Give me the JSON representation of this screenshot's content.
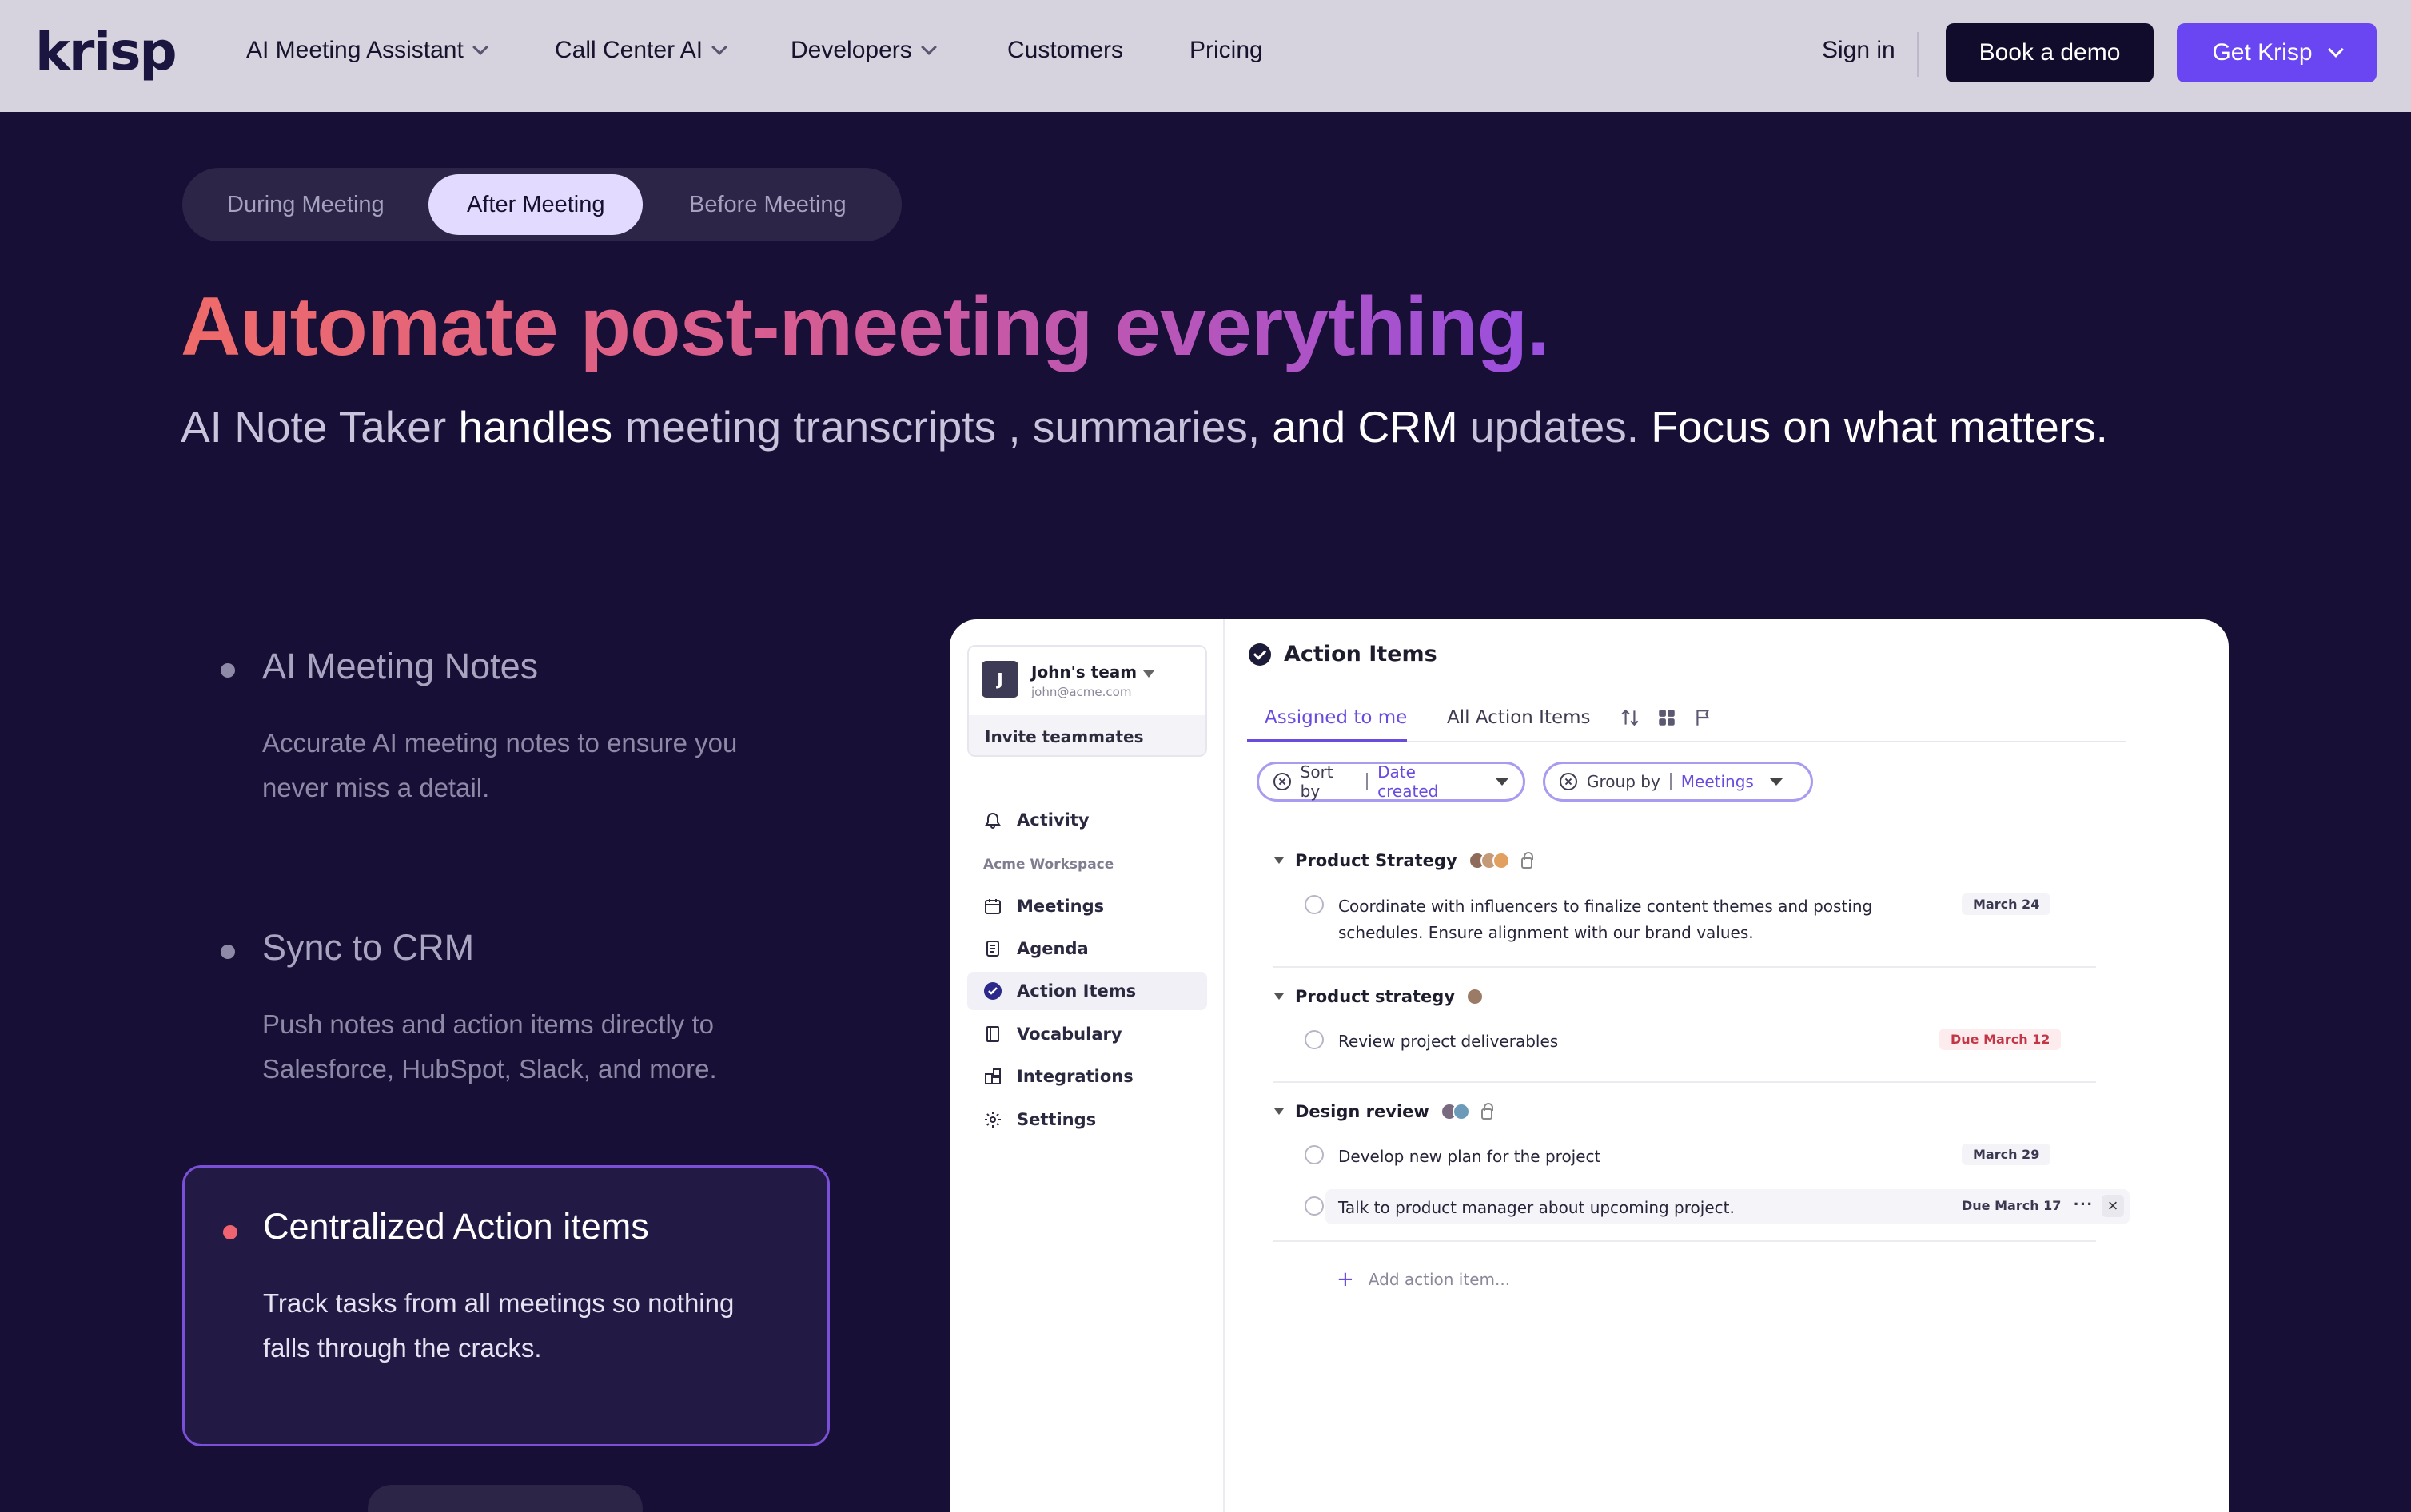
{
  "nav": {
    "logo": "krisp",
    "items": [
      {
        "label": "AI Meeting Assistant",
        "has_dropdown": true
      },
      {
        "label": "Call Center AI",
        "has_dropdown": true
      },
      {
        "label": "Developers",
        "has_dropdown": true
      },
      {
        "label": "Customers",
        "has_dropdown": false
      },
      {
        "label": "Pricing",
        "has_dropdown": false
      }
    ],
    "sign_in": "Sign in",
    "book_demo": "Book a demo",
    "get_krisp": "Get Krisp"
  },
  "tabs": [
    {
      "label": "During Meeting",
      "active": false
    },
    {
      "label": "After Meeting",
      "active": true
    },
    {
      "label": "Before Meeting",
      "active": false
    }
  ],
  "hero": {
    "title": "Automate post-meeting everything.",
    "subtitle_parts": [
      "AI Note Taker ",
      "handles",
      " meeting transcripts , summaries, ",
      "and CRM",
      " updates. ",
      "Focus on what matters."
    ]
  },
  "features": [
    {
      "title": "AI Meeting Notes",
      "text": "Accurate AI meeting notes to ensure you never miss a detail."
    },
    {
      "title": "Sync to CRM",
      "text": "Push notes and action items directly to Salesforce, HubSpot, Slack, and more."
    },
    {
      "title": "Centralized Action items",
      "text": "Track tasks from all meetings so nothing falls through the cracks.",
      "active": true
    }
  ],
  "app": {
    "team": {
      "avatar": "J",
      "name": "John's team",
      "email": "john@acme.com",
      "invite": "Invite teammates"
    },
    "sidebar": {
      "activity": "Activity",
      "section": "Acme Workspace",
      "items": [
        {
          "label": "Meetings",
          "icon": "calendar-icon"
        },
        {
          "label": "Agenda",
          "icon": "document-icon"
        },
        {
          "label": "Action Items",
          "icon": "check-circle-icon",
          "active": true
        },
        {
          "label": "Vocabulary",
          "icon": "book-icon"
        },
        {
          "label": "Integrations",
          "icon": "puzzle-icon"
        },
        {
          "label": "Settings",
          "icon": "gear-icon"
        }
      ]
    },
    "title": "Action Items",
    "subtabs": [
      "Assigned to me",
      "All Action Items"
    ],
    "filters": {
      "sort_label": "Sort by",
      "sort_value": "Date created",
      "group_label": "Group by",
      "group_value": "Meetings"
    },
    "groups": [
      {
        "name": "Product Strategy",
        "tasks": [
          {
            "text": "Coordinate with influencers to finalize content themes and posting schedules. Ensure alignment with our brand values.",
            "date": "March 24",
            "due": false
          }
        ]
      },
      {
        "name": "Product strategy",
        "tasks": [
          {
            "text": "Review project deliverables",
            "date": "Due March 12",
            "due": true
          }
        ]
      },
      {
        "name": "Design review",
        "tasks": [
          {
            "text": "Develop new plan for the project",
            "date": "March 29",
            "due": false
          },
          {
            "text": "Talk to product manager about upcoming project.",
            "date": "Due March 17",
            "due": false
          }
        ]
      }
    ],
    "add_item": "Add action item...",
    "more_glyph": "···",
    "close_glyph": "×"
  },
  "colors": {
    "page_bg": "#170f35",
    "nav_bg": "#d6d3de",
    "accent": "#6a45f2",
    "gradient_start": "#ef6b69",
    "gradient_end": "#9a4fdf",
    "due_red": "#c23645"
  }
}
